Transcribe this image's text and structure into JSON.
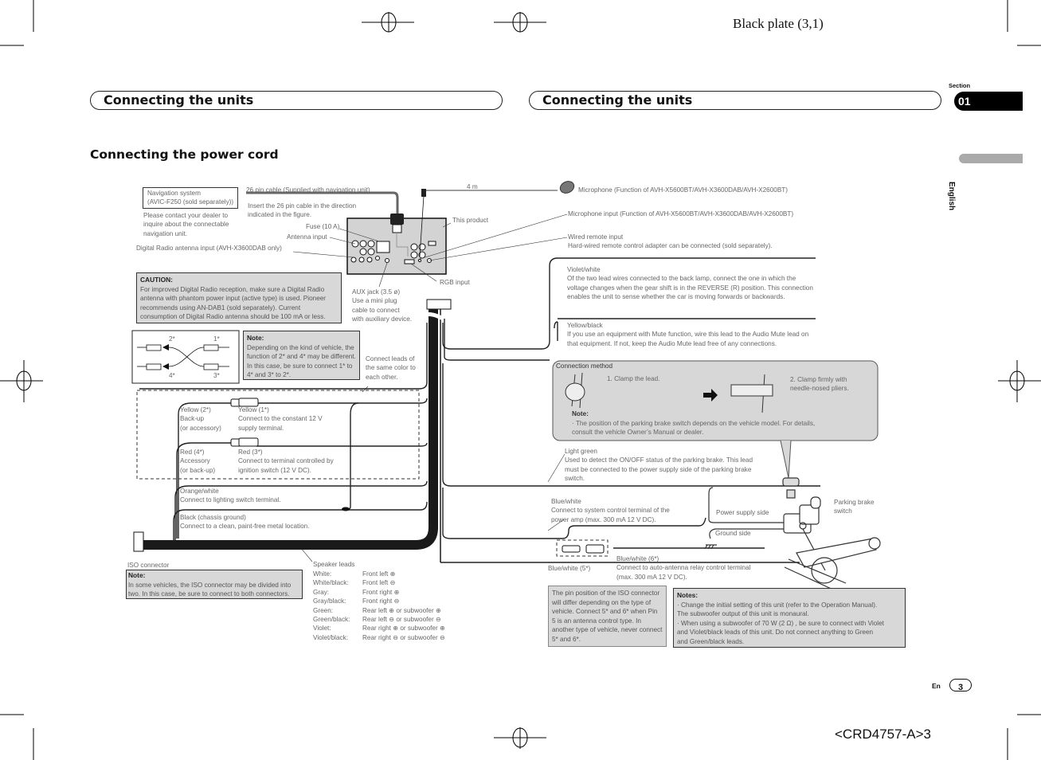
{
  "print_marks": {
    "plate_label": "Black plate (3,1)",
    "doc_code": "<CRD4757-A>3"
  },
  "header": {
    "left_title": "Connecting the units",
    "right_title": "Connecting the units",
    "section_label": "Section",
    "section_number": "01",
    "language_tab": "English"
  },
  "page_heading": "Connecting the power cord",
  "footer": {
    "lang": "En",
    "page_number": "3"
  },
  "diagram": {
    "nav_system_box": "Navigation system\n(AVIC-F250 (sold separately))",
    "nav_contact": "Please contact your dealer to\ninquire about the connectable\nnavigation unit.",
    "cable_26pin": "26 pin cable (Supplied with navigation unit)",
    "insert_26pin": "Insert the 26 pin cable in the direction\nindicated in the figure.",
    "fuse": "Fuse (10 A)",
    "antenna_input": "Antenna input",
    "dab_antenna_input": "Digital Radio antenna input (AVH-X3600DAB only)",
    "this_product": "This product",
    "rgb_input": "RGB input",
    "aux_jack": "AUX jack (3.5 ø)\nUse a mini plug\ncable to connect\nwith auxiliary device.",
    "cable_length": "4 m",
    "microphone": "Microphone (Function of AVH-X5600BT/AVH-X3600DAB/AVH-X2600BT)",
    "microphone_input": "Microphone input (Function of AVH-X5600BT/AVH-X3600DAB/AVH-X2600BT)",
    "wired_remote": "Wired remote input\nHard-wired remote control adapter can be connected (sold separately).",
    "caution": {
      "title": "CAUTION:",
      "text": "For improved Digital Radio reception, make sure a Digital Radio antenna with phantom power input (active type) is used. Pioneer recommends using AN-DAB1 (sold separately). Current consumption of Digital Radio antenna should be 100 mA or less."
    },
    "swap_labels": [
      "2*",
      "1*",
      "4*",
      "3*"
    ],
    "swap_note": {
      "title": "Note:",
      "text": "Depending on the kind of vehicle, the function of 2* and 4* may be different. In this case, be sure to connect 1* to 4* and 3* to 2*."
    },
    "same_color": "Connect leads of\nthe same color to\neach other.",
    "yellow2": "Yellow (2*)\nBack-up\n(or accessory)",
    "yellow1": "Yellow (1*)\nConnect to the constant 12 V\nsupply terminal.",
    "red4": "Red (4*)\nAccessory\n(or back-up)",
    "red3": "Red (3*)\nConnect to terminal controlled by\nignition switch (12 V DC).",
    "orange_white": "Orange/white\nConnect to lighting switch terminal.",
    "black_ground": "Black (chassis ground)\nConnect to a clean, paint-free metal location.",
    "iso_connector": "ISO connector",
    "iso_note": {
      "title": "Note:",
      "text": "In some vehicles, the ISO connector may be divided into two. In this case, be sure to connect to both connectors."
    },
    "speaker_leads": {
      "title": "Speaker leads",
      "rows": [
        {
          "color": "White:",
          "use": "Front left ⊕"
        },
        {
          "color": "White/black:",
          "use": "Front left ⊖"
        },
        {
          "color": "Gray:",
          "use": "Front right ⊕"
        },
        {
          "color": "Gray/black:",
          "use": "Front right ⊖"
        },
        {
          "color": "Green:",
          "use": "Rear left ⊕ or subwoofer ⊕"
        },
        {
          "color": "Green/black:",
          "use": "Rear left ⊖ or subwoofer ⊖"
        },
        {
          "color": "Violet:",
          "use": "Rear right ⊕ or subwoofer ⊕"
        },
        {
          "color": "Violet/black:",
          "use": "Rear right ⊖ or subwoofer ⊖"
        }
      ]
    },
    "violet_white": "Violet/white\nOf the two lead wires connected to the back lamp, connect the one in which the\nvoltage changes when the gear shift is in the REVERSE (R) position. This connection\nenables the unit to sense whether the car is moving forwards or backwards.",
    "yellow_black": "Yellow/black\nIf you use an equipment with Mute function, wire this lead to the Audio Mute lead on\nthat equipment. If not, keep the Audio Mute lead free of any connections.",
    "connection_method": {
      "title": "Connection method",
      "step1": "1.  Clamp the lead.",
      "step2": "2. Clamp firmly with\n    needle-nosed pliers.",
      "note_title": "Note:",
      "note_text": "·  The position of the parking brake switch depends on the vehicle model. For details,\n    consult the vehicle Owner’s Manual or dealer."
    },
    "light_green": "Light green\nUsed to detect the ON/OFF status of the parking brake. This lead\nmust be connected to the power supply side of the parking brake\nswitch.",
    "power_supply_side": "Power supply side",
    "ground_side": "Ground side",
    "parking_brake_switch": "Parking brake\nswitch",
    "blue_white": "Blue/white\nConnect to system control terminal of the\npower amp (max. 300 mA 12 V DC).",
    "blue_white5": "Blue/white (5*)",
    "blue_white6": "Blue/white (6*)\nConnect to auto-antenna relay control terminal\n(max. 300 mA 12 V DC).",
    "pin_note": "The pin position of the ISO connector will differ depending on the type of vehicle. Connect 5* and 6* when Pin 5 is an antenna control type. In another type of vehicle, never connect 5* and 6*.",
    "notes": {
      "title": "Notes:",
      "items": [
        "·  Change the initial setting of this unit (refer to the Operation Manual).\n   The subwoofer output of this unit is monaural.",
        "·  When using a subwoofer of 70 W (2 Ω) , be sure to connect with Violet\n   and Violet/black leads of this unit. Do not connect anything to Green\n   and Green/black leads."
      ]
    }
  }
}
